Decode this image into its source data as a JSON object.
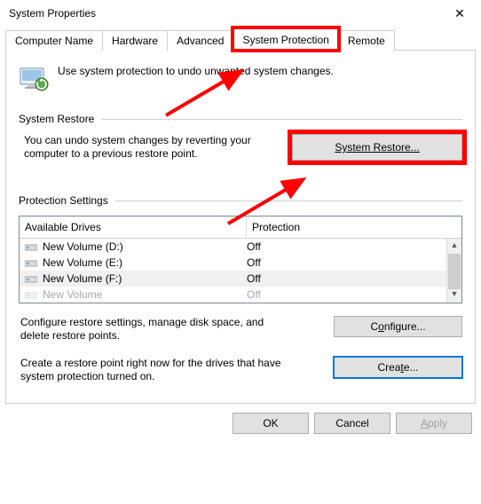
{
  "window": {
    "title": "System Properties"
  },
  "tabs": {
    "t1": "Computer Name",
    "t2": "Hardware",
    "t3": "Advanced",
    "t4": "System Protection",
    "t5": "Remote"
  },
  "intro": "Use system protection to undo unwanted system changes.",
  "group_restore": "System Restore",
  "restore_desc": "You can undo system changes by reverting your computer to a previous restore point.",
  "restore_btn": "System Restore...",
  "group_protection": "Protection Settings",
  "col_drives": "Available Drives",
  "col_protection": "Protection",
  "drives": [
    {
      "name": "New Volume (D:)",
      "prot": "Off"
    },
    {
      "name": "New Volume (E:)",
      "prot": "Off"
    },
    {
      "name": "New Volume (F:)",
      "prot": "Off"
    },
    {
      "name": "New Volume",
      "prot": "Off"
    }
  ],
  "configure_desc": "Configure restore settings, manage disk space, and delete restore points.",
  "configure_btn_prefix": "C",
  "configure_btn_suffix": "nfigure...",
  "configure_btn_ul": "o",
  "create_desc": "Create a restore point right now for the drives that have system protection turned on.",
  "create_btn_prefix": "Crea",
  "create_btn_ul": "t",
  "create_btn_suffix": "e...",
  "dlg": {
    "ok": "OK",
    "cancel": "Cancel",
    "apply_prefix": "",
    "apply_ul": "A",
    "apply_suffix": "pply"
  }
}
